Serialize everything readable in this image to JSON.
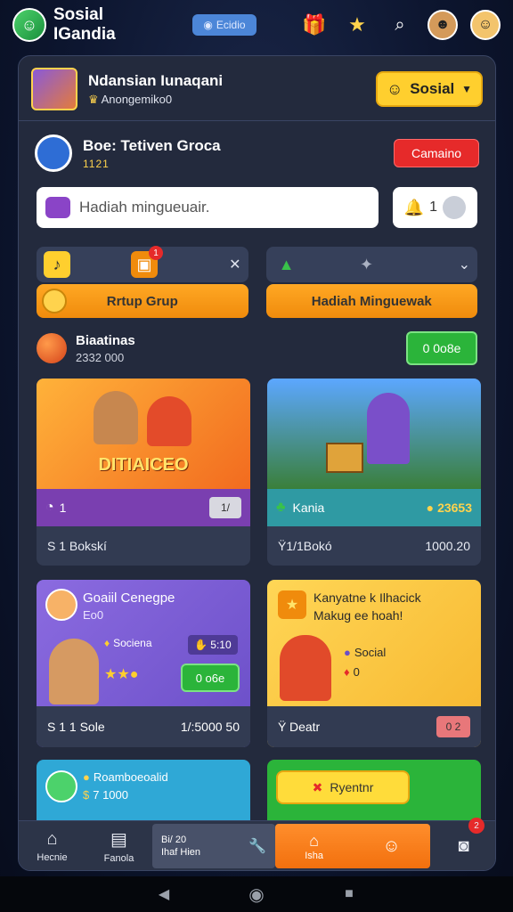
{
  "header": {
    "app_title": "Sosial IGandia",
    "pill_label": "Ecidio"
  },
  "profile": {
    "name": "Ndansian Iunaqani",
    "subtitle": "Anongemiko0",
    "social_button": "Sosial"
  },
  "group": {
    "name": "Boe: Tetiven Groca",
    "code": "1121",
    "action_button": "Camaino"
  },
  "search": {
    "value": "Hadiah mingueuair.",
    "count": "1"
  },
  "tabs": {
    "left_badge": "1"
  },
  "actions": {
    "left_button": "Rrtup Grup",
    "right_button": "Hadiah Minguewak"
  },
  "section": {
    "title": "Biaatinas",
    "subtitle": "2332 000",
    "button": "0 0o8e"
  },
  "cards": [
    {
      "banner": "DITIAICEO",
      "bar_value": "1",
      "bar_pill": "1/",
      "footer_left": "S 1 Bokskí",
      "footer_right": ""
    },
    {
      "bar_label": "Kania",
      "bar_value": "23653",
      "footer_left": "Ϋ1/1Bokó",
      "footer_right": "1000.20"
    },
    {
      "title": "Goaiil Cenegpe",
      "subtitle": "Eo0",
      "tag1": "Sociena",
      "tag2": "5:10",
      "button": "0 o6e",
      "footer_left": "S 1 1 Sole",
      "footer_right": "1/:5000 50"
    },
    {
      "title_line1": "Kanyatne k Ilhacick",
      "title_line2": "Makug ee hoah!",
      "tag": "Social",
      "small_value": "0",
      "footer_left": "Ϋ Deatr",
      "footer_pill": "0 2"
    }
  ],
  "bottom_cards": {
    "left_line1": "Roamboeoalid",
    "left_line2": "7 1000",
    "right_button": "Ryentnr"
  },
  "nav": {
    "home": "Hecnie",
    "second": "Fanola",
    "mid_label1": "Bi/ 20",
    "mid_label2": "Ihaf Hien",
    "active_label": "Isha",
    "badge": "2"
  },
  "colors": {
    "accent_orange": "#f08b0c",
    "accent_yellow": "#ffcf2e",
    "accent_red": "#e62a2a",
    "accent_green": "#2bb43a",
    "panel": "#232a3d"
  }
}
